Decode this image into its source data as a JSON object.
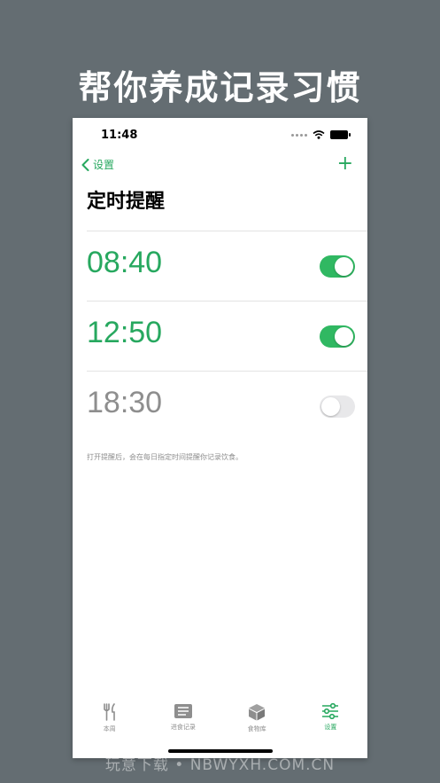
{
  "headline": "帮你养成记录习惯",
  "status_bar": {
    "time": "11:48"
  },
  "nav": {
    "back_label": "设置",
    "add_label": "+"
  },
  "page_title": "定时提醒",
  "alarms": [
    {
      "time": "08:40",
      "enabled": true
    },
    {
      "time": "12:50",
      "enabled": true
    },
    {
      "time": "18:30",
      "enabled": false
    }
  ],
  "footnote": "打开提醒后，会在每日指定时间提醒你记录饮食。",
  "tabs": [
    {
      "label": "本周",
      "icon": "fork-knife-icon",
      "active": false
    },
    {
      "label": "进食记录",
      "icon": "list-icon",
      "active": false
    },
    {
      "label": "食物库",
      "icon": "box-icon",
      "active": false
    },
    {
      "label": "设置",
      "icon": "sliders-icon",
      "active": true
    }
  ],
  "watermark": "玩意下载 • NBWYXH.COM.CN",
  "colors": {
    "accent": "#27a85f",
    "background": "#646d72",
    "toggle_on": "#30b862",
    "toggle_off": "#e8e8ea"
  }
}
